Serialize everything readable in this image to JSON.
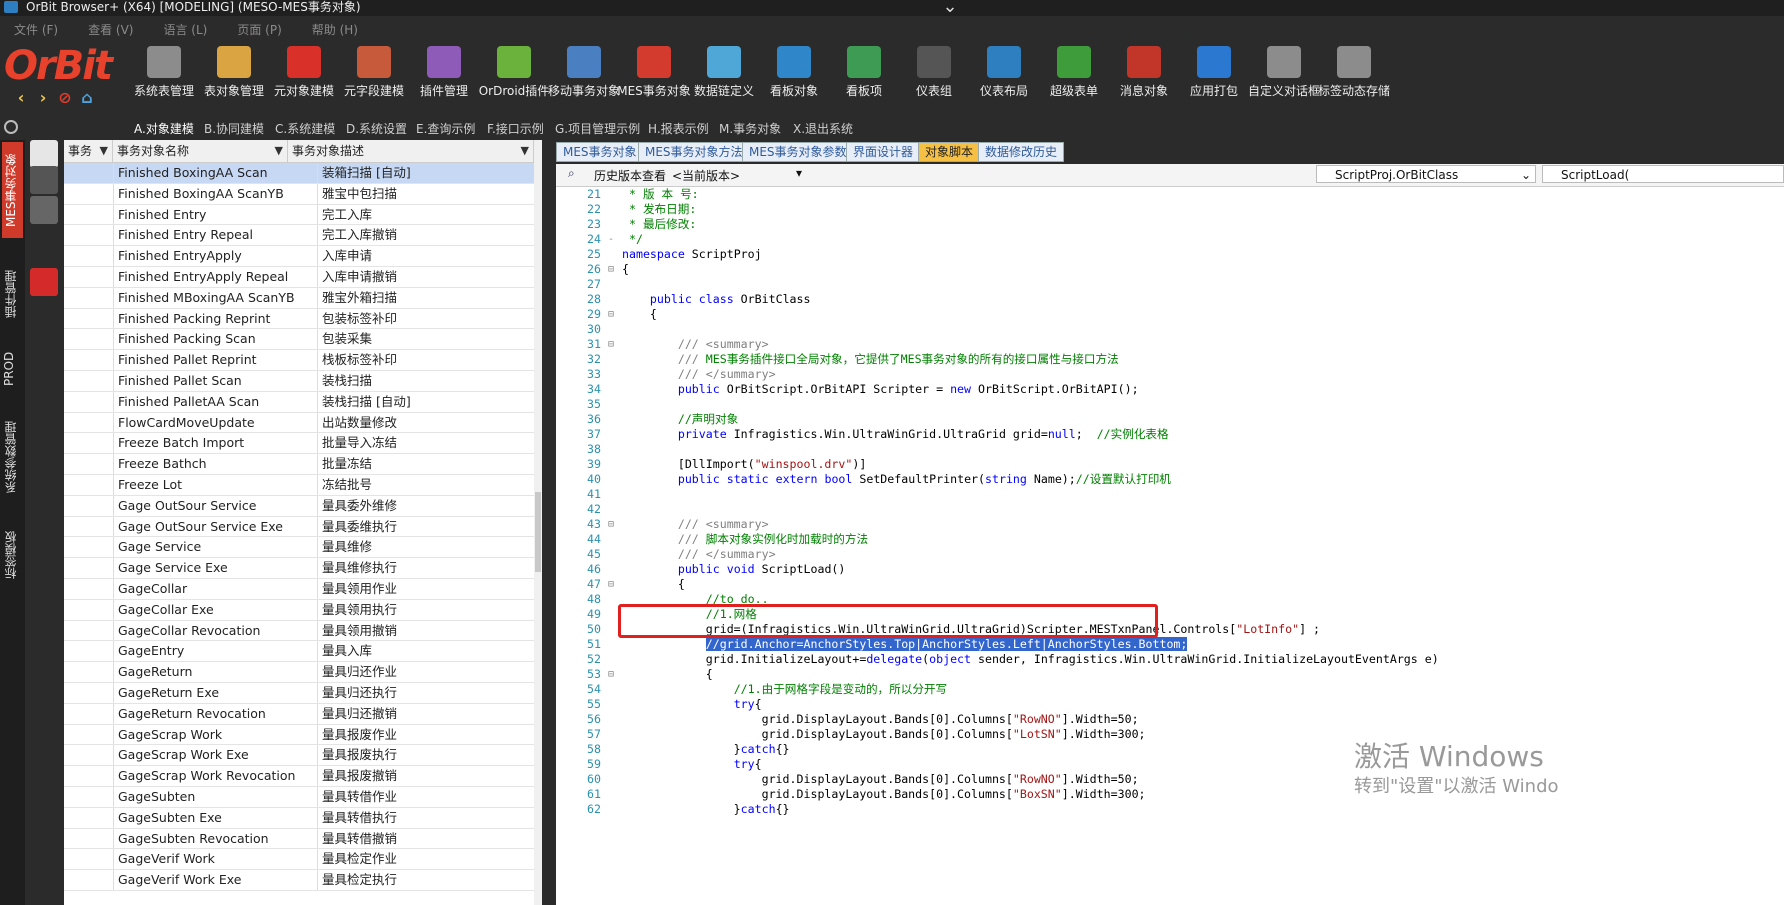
{
  "window": {
    "title": "OrBit Browser+ (X64) [MODELING] (MESO-MES事务对象)"
  },
  "menu": [
    "文件 (F)",
    "查看 (V)",
    "语言 (L)",
    "页面 (P)",
    "帮助 (H)"
  ],
  "logo": "OrBit",
  "toolbar": [
    {
      "label": "系统表管理",
      "color": "#8c8c8c"
    },
    {
      "label": "表对象管理",
      "color": "#d9a441"
    },
    {
      "label": "元对象建模",
      "color": "#d9302a"
    },
    {
      "label": "元字段建模",
      "color": "#c65a3a"
    },
    {
      "label": "插件管理",
      "color": "#8e5bb8"
    },
    {
      "label": "OrDroid插件",
      "color": "#6bb23c"
    },
    {
      "label": "移动事务对象",
      "color": "#4a7fc1"
    },
    {
      "label": "MES事务对象",
      "color": "#d33b2f"
    },
    {
      "label": "数据链定义",
      "color": "#4fa7d8"
    },
    {
      "label": "看板对象",
      "color": "#2f86c9"
    },
    {
      "label": "看板项",
      "color": "#3e9b54"
    },
    {
      "label": "仪表组",
      "color": "#555555"
    },
    {
      "label": "仪表布局",
      "color": "#2e7fc0"
    },
    {
      "label": "超级表单",
      "color": "#3f9c3a"
    },
    {
      "label": "消息对象",
      "color": "#c2362a"
    },
    {
      "label": "应用打包",
      "color": "#2b78d0"
    },
    {
      "label": "自定义对话框",
      "color": "#8c8c8c"
    },
    {
      "label": "标签动态存储",
      "color": "#8c8c8c"
    }
  ],
  "subtabs": [
    "A.对象建模",
    "B.协同建模",
    "C.系统建模",
    "D.系统设置",
    "E.查询示例",
    "F.接口示例",
    "G.项目管理示例",
    "H.报表示例",
    "M.事务对象",
    "X.退出系统"
  ],
  "side_tabs": [
    "MES事务对象",
    "插件管理",
    "PROD",
    "系统参数管理",
    "标签模板"
  ],
  "list": {
    "headers": [
      "事务",
      "事务对象名称",
      "事务对象描述"
    ],
    "rows": [
      [
        "Finished BoxingAA Scan",
        "装箱扫描 [自动]"
      ],
      [
        "Finished BoxingAA ScanYB",
        "雅宝中包扫描"
      ],
      [
        "Finished Entry",
        "完工入库"
      ],
      [
        "Finished Entry Repeal",
        "完工入库撤销"
      ],
      [
        "Finished EntryApply",
        "入库申请"
      ],
      [
        "Finished EntryApply Repeal",
        "入库申请撤销"
      ],
      [
        "Finished MBoxingAA ScanYB",
        "雅宝外箱扫描"
      ],
      [
        "Finished Packing Reprint",
        "包装标签补印"
      ],
      [
        "Finished Packing Scan",
        "包装采集"
      ],
      [
        "Finished Pallet Reprint",
        "栈板标签补印"
      ],
      [
        "Finished Pallet Scan",
        "装栈扫描"
      ],
      [
        "Finished PalletAA Scan",
        "装栈扫描 [自动]"
      ],
      [
        "FlowCardMoveUpdate",
        "出站数量修改"
      ],
      [
        "Freeze Batch Import",
        "批量导入冻结"
      ],
      [
        "Freeze Bathch",
        "批量冻结"
      ],
      [
        "Freeze Lot",
        "冻结批号"
      ],
      [
        "Gage OutSour Service",
        "量具委外维修"
      ],
      [
        "Gage OutSour Service Exe",
        "量具委维执行"
      ],
      [
        "Gage Service",
        "量具维修"
      ],
      [
        "Gage Service Exe",
        "量具维修执行"
      ],
      [
        "GageCollar",
        "量具领用作业"
      ],
      [
        "GageCollar Exe",
        "量具领用执行"
      ],
      [
        "GageCollar Revocation",
        "量具领用撤销"
      ],
      [
        "GageEntry",
        "量具入库"
      ],
      [
        "GageReturn",
        "量具归还作业"
      ],
      [
        "GageReturn Exe",
        "量具归还执行"
      ],
      [
        "GageReturn Revocation",
        "量具归还撤销"
      ],
      [
        "GageScrap Work",
        "量具报废作业"
      ],
      [
        "GageScrap Work Exe",
        "量具报废执行"
      ],
      [
        "GageScrap Work Revocation",
        "量具报废撤销"
      ],
      [
        "GageSubten",
        "量具转借作业"
      ],
      [
        "GageSubten Exe",
        "量具转借执行"
      ],
      [
        "GageSubten Revocation",
        "量具转借撤销"
      ],
      [
        "GageVerif Work",
        "量具检定作业"
      ],
      [
        "GageVerif Work Exe",
        "量具检定执行"
      ]
    ]
  },
  "doc_tabs": [
    "MES事务对象",
    "MES事务对象方法",
    "MES事务对象参数",
    "界面设计器",
    "对象脚本",
    "数据修改历史"
  ],
  "editor_bar": {
    "history": "历史版本查看",
    "version": "<当前版本>",
    "class_select": "ScriptProj.OrBitClass",
    "method_select": "ScriptLoad("
  },
  "code": [
    {
      "n": "21",
      "t": " * 版 本 号:"
    },
    {
      "n": "22",
      "t": " * 发布日期:"
    },
    {
      "n": "23",
      "t": " * 最后修改:"
    },
    {
      "n": "24",
      "t": " */"
    },
    {
      "n": "25",
      "t": "namespace ScriptProj"
    },
    {
      "n": "26",
      "t": "{"
    },
    {
      "n": "27",
      "t": ""
    },
    {
      "n": "28",
      "t": "    public class OrBitClass"
    },
    {
      "n": "29",
      "t": "    {"
    },
    {
      "n": "30",
      "t": ""
    },
    {
      "n": "31",
      "t": "        /// <summary>"
    },
    {
      "n": "32",
      "t": "        /// MES事务插件接口全局对象，它提供了MES事务对象的所有的接口属性与接口方法"
    },
    {
      "n": "33",
      "t": "        /// </summary>"
    },
    {
      "n": "34",
      "t": "        public OrBitScript.OrBitAPI Scripter = new OrBitScript.OrBitAPI();"
    },
    {
      "n": "35",
      "t": ""
    },
    {
      "n": "36",
      "t": "        //声明对象"
    },
    {
      "n": "37",
      "t": "        private Infragistics.Win.UltraWinGrid.UltraGrid grid=null;  //实例化表格"
    },
    {
      "n": "38",
      "t": ""
    },
    {
      "n": "39",
      "t": "        [DllImport(\"winspool.drv\")]"
    },
    {
      "n": "40",
      "t": "        public static extern bool SetDefaultPrinter(string Name);//设置默认打印机"
    },
    {
      "n": "41",
      "t": ""
    },
    {
      "n": "42",
      "t": ""
    },
    {
      "n": "43",
      "t": "        /// <summary>"
    },
    {
      "n": "44",
      "t": "        /// 脚本对象实例化时加载时的方法"
    },
    {
      "n": "45",
      "t": "        /// </summary>"
    },
    {
      "n": "46",
      "t": "        public void ScriptLoad()"
    },
    {
      "n": "47",
      "t": "        {"
    },
    {
      "n": "48",
      "t": "            //to do.."
    },
    {
      "n": "49",
      "t": "            //1.网格"
    },
    {
      "n": "50",
      "t": "            grid=(Infragistics.Win.UltraWinGrid.UltraGrid)Scripter.MESTxnPanel.Controls[\"LotInfo\"] ;"
    },
    {
      "n": "51",
      "t": "            //grid.Anchor=AnchorStyles.Top|AnchorStyles.Left|AnchorStyles.Bottom;"
    },
    {
      "n": "52",
      "t": "            grid.InitializeLayout+=delegate(object sender, Infragistics.Win.UltraWinGrid.InitializeLayoutEventArgs e)"
    },
    {
      "n": "53",
      "t": "            {"
    },
    {
      "n": "54",
      "t": "                //1.由于网格字段是变动的，所以分开写"
    },
    {
      "n": "55",
      "t": "                try{"
    },
    {
      "n": "56",
      "t": "                    grid.DisplayLayout.Bands[0].Columns[\"RowNO\"].Width=50;"
    },
    {
      "n": "57",
      "t": "                    grid.DisplayLayout.Bands[0].Columns[\"LotSN\"].Width=300;"
    },
    {
      "n": "58",
      "t": "                }catch{}"
    },
    {
      "n": "59",
      "t": "                try{"
    },
    {
      "n": "60",
      "t": "                    grid.DisplayLayout.Bands[0].Columns[\"RowNO\"].Width=50;"
    },
    {
      "n": "61",
      "t": "                    grid.DisplayLayout.Bands[0].Columns[\"BoxSN\"].Width=300;"
    },
    {
      "n": "62",
      "t": "                }catch{}"
    }
  ],
  "watermark": {
    "line1": "激活 Windows",
    "line2": "转到\"设置\"以激活 Windo"
  }
}
